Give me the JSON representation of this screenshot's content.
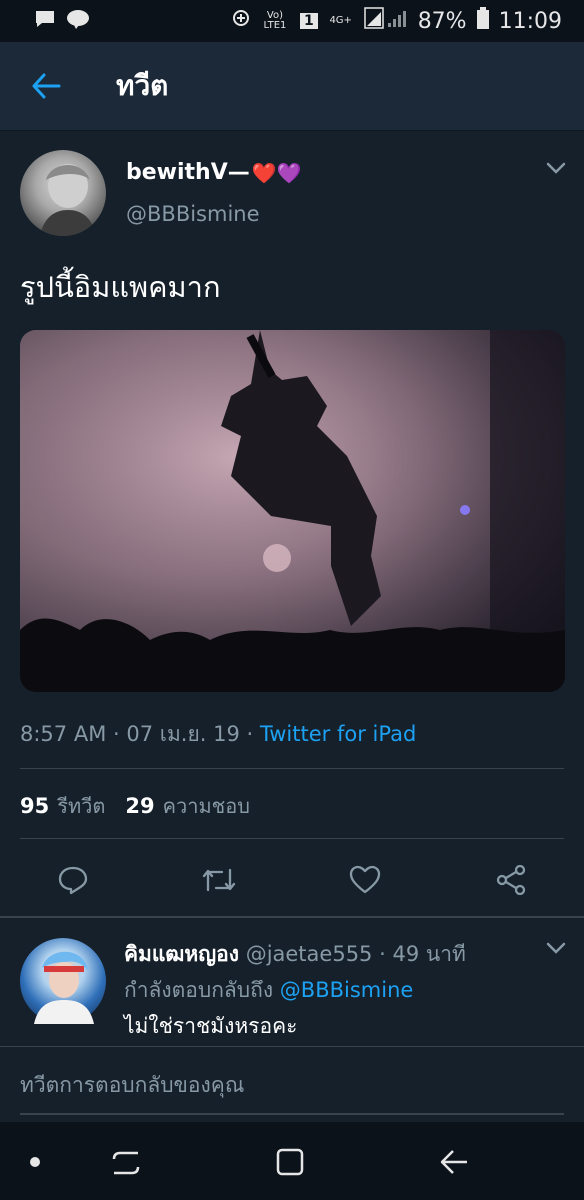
{
  "status_bar": {
    "network_small": "Vo) LTE1",
    "sim": "1",
    "network_type": "4G+",
    "battery_percent": "87%",
    "time": "11:09"
  },
  "header": {
    "title": "ทวีต"
  },
  "tweet": {
    "display_name": "bewithV—",
    "emoji": "❤️💜",
    "handle": "@BBBismine",
    "text": "รูปนี้อิมแพคมาก",
    "time": "8:57 AM",
    "date": "07 เม.ย. 19",
    "source": "Twitter for iPad",
    "retweet_count": "95",
    "retweet_label": "รีทวีต",
    "like_count": "29",
    "like_label": "ความชอบ"
  },
  "reply": {
    "display_name": "คิมแฒหญอง",
    "handle": "@jaetae555",
    "age": "49 นาที",
    "replying_to_label": "กำลังตอบกลับถึง",
    "replying_to_handle": "@BBBismine",
    "text": "ไม่ใช่ราชมังหรอคะ"
  },
  "compose": {
    "placeholder": "ทวีตการตอบกลับของคุณ"
  },
  "colors": {
    "background": "#15202b",
    "accent": "#1da1f2",
    "secondary_text": "#8899a6"
  }
}
